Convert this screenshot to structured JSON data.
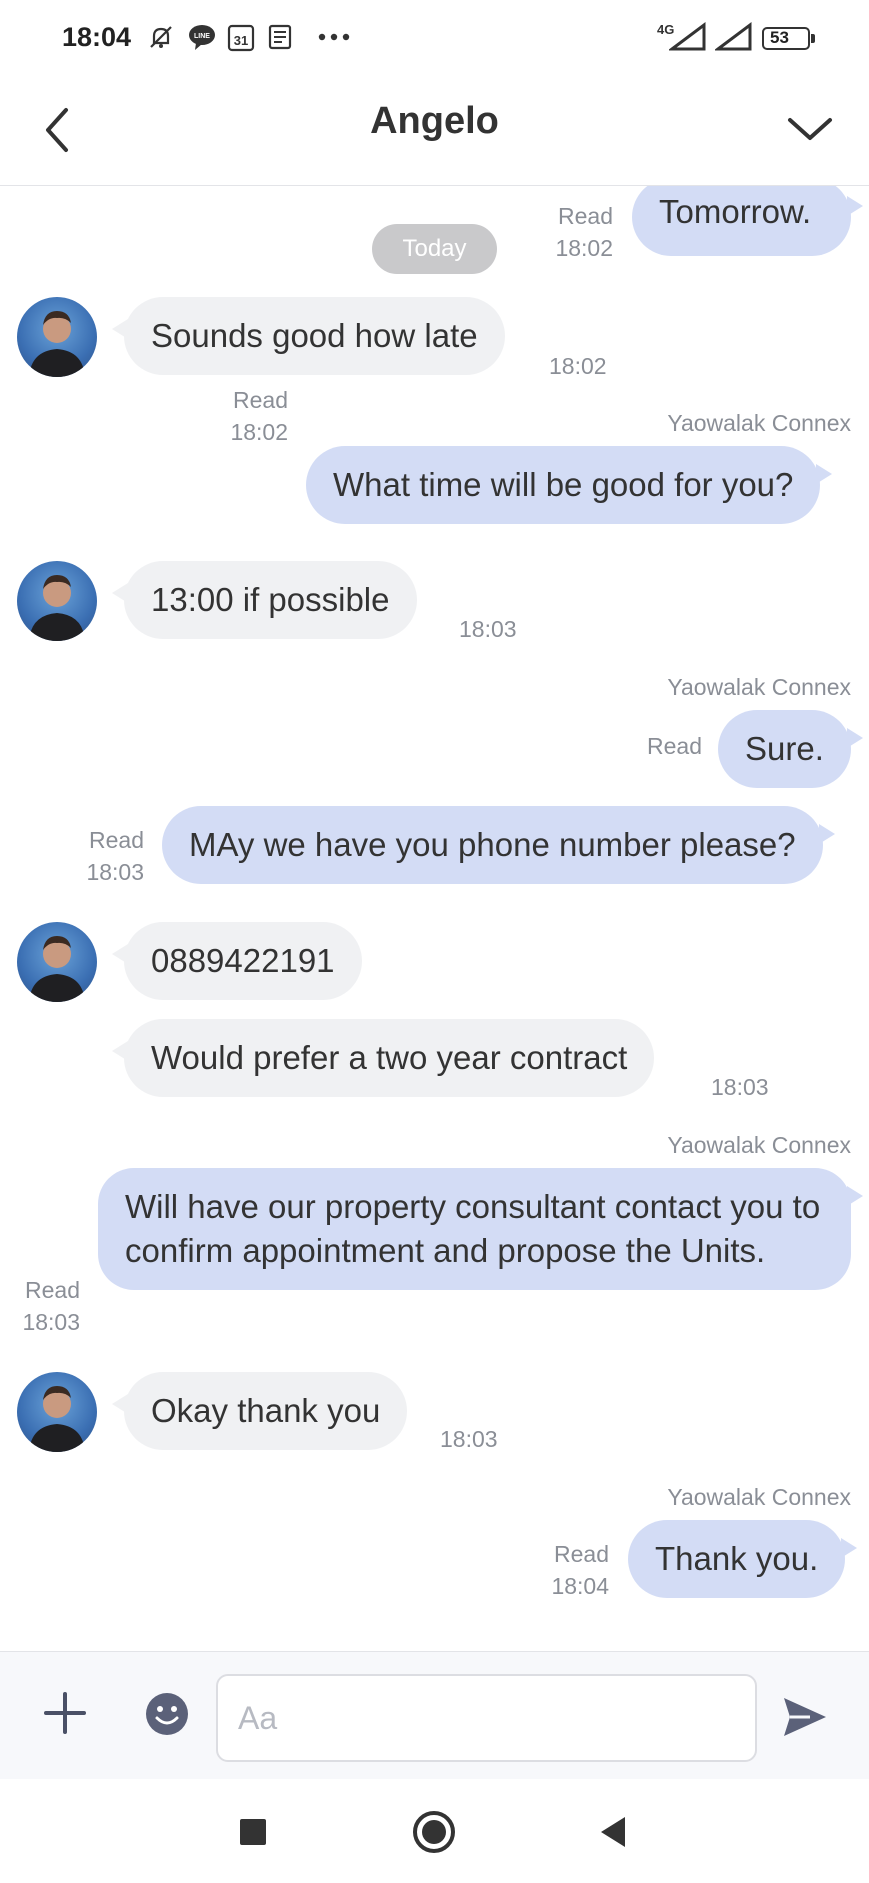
{
  "status_bar": {
    "time": "18:04",
    "network": "4G",
    "battery": "53"
  },
  "header": {
    "title": "Angelo"
  },
  "date_divider": "Today",
  "messages": [
    {
      "dir": "out",
      "text": "Tomorrow.",
      "status": "Read",
      "time": "18:02"
    },
    {
      "dir": "in",
      "text": "Sounds good how late",
      "time": "18:02"
    },
    {
      "dir": "out",
      "sender": "Yaowalak Connex",
      "text": "What time will be good for you?",
      "status": "Read",
      "time": "18:02"
    },
    {
      "dir": "in",
      "text": "13:00 if possible",
      "time": "18:03"
    },
    {
      "dir": "out",
      "sender": "Yaowalak Connex",
      "text": "Sure.",
      "status": "Read"
    },
    {
      "dir": "out",
      "text": "MAy we have you phone number please?",
      "status": "Read",
      "time": "18:03"
    },
    {
      "dir": "in",
      "text": "0889422191"
    },
    {
      "dir": "in",
      "text": "Would prefer a two year contract",
      "time": "18:03"
    },
    {
      "dir": "out",
      "sender": "Yaowalak Connex",
      "text": "Will have our property consultant contact you to confirm appointment and propose the Units.",
      "status": "Read",
      "time": "18:03"
    },
    {
      "dir": "in",
      "text": "Okay thank you",
      "time": "18:03"
    },
    {
      "dir": "out",
      "sender": "Yaowalak Connex",
      "text": "Thank you.",
      "status": "Read",
      "time": "18:04"
    }
  ],
  "input": {
    "placeholder": "Aa",
    "value": ""
  },
  "icons": {
    "back": "chevron-left-icon",
    "collapse": "chevron-down-icon",
    "plus": "plus-icon",
    "emoji": "emoji-icon",
    "send": "send-icon",
    "nav_recents": "square-icon",
    "nav_home": "circle-icon",
    "nav_back": "triangle-back-icon"
  },
  "colors": {
    "incoming_bubble": "#f0f1f3",
    "outgoing_bubble": "#d3dcf5",
    "meta_text": "#8a8e96"
  }
}
